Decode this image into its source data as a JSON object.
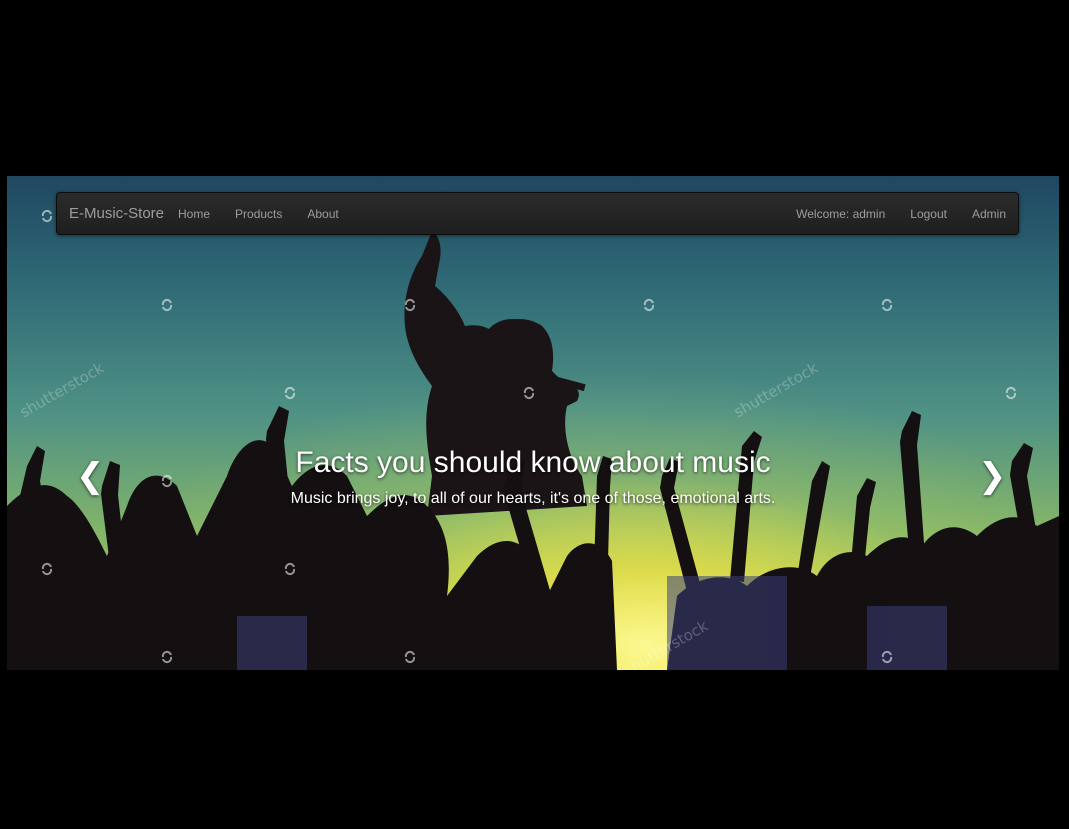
{
  "navbar": {
    "brand": "E-Music-Store",
    "links": [
      "Home",
      "Products",
      "About"
    ],
    "right_links": [
      "Welcome: admin",
      "Logout",
      "Admin"
    ]
  },
  "carousel": {
    "title": "Facts you should know about music",
    "text": "Music brings joy, to all of our hearts, it's one of those, emotional arts.",
    "prev_icon": "chevron-left-icon",
    "next_icon": "chevron-right-icon",
    "prev_glyph": "❮",
    "next_glyph": "❯",
    "watermark": "shutterstock"
  },
  "colors": {
    "page_bg": "#000000",
    "navbar_bg": "#222222",
    "nav_text": "#9d9d9d",
    "caption_text": "#ffffff"
  }
}
